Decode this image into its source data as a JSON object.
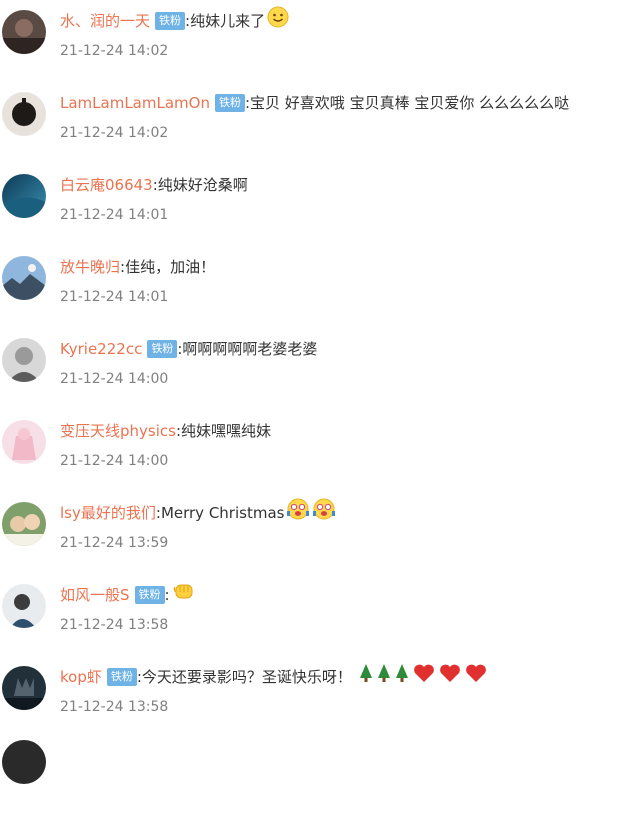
{
  "comments": [
    {
      "username": "水、润的一天",
      "badge": "铁粉",
      "text": "纯妹儿来了",
      "emojis": [
        "smile"
      ],
      "time": "21-12-24 14:02"
    },
    {
      "username": "LamLamLamLamOn",
      "badge": "铁粉",
      "text": "宝贝 好喜欢哦 宝贝真棒 宝贝爱你 么么么么么哒",
      "emojis": [],
      "time": "21-12-24 14:02"
    },
    {
      "username": "白云庵06643",
      "badge": "",
      "text": "纯妹好沧桑啊",
      "emojis": [],
      "time": "21-12-24 14:01"
    },
    {
      "username": "放牛晚归",
      "badge": "",
      "text": "佳纯，加油！",
      "emojis": [],
      "time": "21-12-24 14:01"
    },
    {
      "username": "Kyrie222cc",
      "badge": "铁粉",
      "text": "啊啊啊啊啊老婆老婆",
      "emojis": [],
      "time": "21-12-24 14:00"
    },
    {
      "username": "变压天线physics",
      "badge": "",
      "text": "纯妹嘿嘿纯妹",
      "emojis": [],
      "time": "21-12-24 14:00"
    },
    {
      "username": "lsy最好的我们",
      "badge": "",
      "text": "Merry Christmas",
      "emojis": [
        "excited",
        "excited"
      ],
      "time": "21-12-24 13:59"
    },
    {
      "username": "如风一般S",
      "badge": "铁粉",
      "text": "",
      "emojis": [
        "fist"
      ],
      "time": "21-12-24 13:58"
    },
    {
      "username": "kop虾",
      "badge": "铁粉",
      "text": "今天还要录影吗？圣诞快乐呀！",
      "emojis": [
        "tree",
        "tree",
        "tree",
        "heart",
        "heart",
        "heart"
      ],
      "time": "21-12-24 13:58"
    }
  ],
  "colors": {
    "username": "#eb7350",
    "badge_bg": "#6fb3e6",
    "text": "#333333",
    "time": "#808080"
  }
}
